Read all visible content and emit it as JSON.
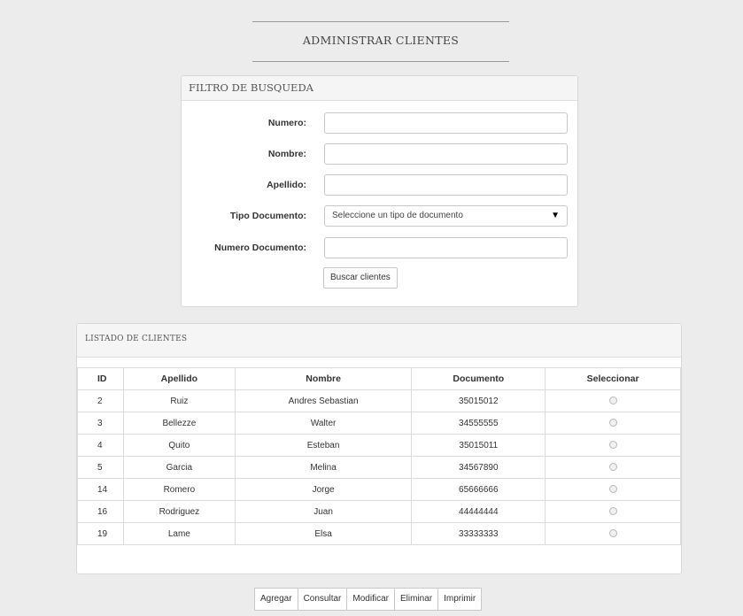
{
  "page": {
    "title": "ADMINISTRAR CLIENTES"
  },
  "filter": {
    "header": "FILTRO DE BUSQUEDA",
    "fields": [
      {
        "label": "Numero:",
        "value": ""
      },
      {
        "label": "Nombre:",
        "value": ""
      },
      {
        "label": "Apellido:",
        "value": ""
      },
      {
        "label": "Tipo Documento:",
        "value": "Seleccione un tipo de documento"
      },
      {
        "label": "Numero Documento:",
        "value": ""
      }
    ],
    "search_button": "Buscar clientes"
  },
  "clients": {
    "header": "LISTADO DE CLIENTES",
    "columns": [
      "ID",
      "Apellido",
      "Nombre",
      "Documento",
      "Seleccionar"
    ],
    "rows": [
      {
        "id": "2",
        "apellido": "Ruiz",
        "nombre": "Andres Sebastian",
        "documento": "35015012"
      },
      {
        "id": "3",
        "apellido": "Bellezze",
        "nombre": "Walter",
        "documento": "34555555"
      },
      {
        "id": "4",
        "apellido": "Quito",
        "nombre": "Esteban",
        "documento": "35015011"
      },
      {
        "id": "5",
        "apellido": "Garcia",
        "nombre": "Melina",
        "documento": "34567890"
      },
      {
        "id": "14",
        "apellido": "Romero",
        "nombre": "Jorge",
        "documento": "65666666"
      },
      {
        "id": "16",
        "apellido": "Rodriguez",
        "nombre": "Juan",
        "documento": "44444444"
      },
      {
        "id": "19",
        "apellido": "Lame",
        "nombre": "Elsa",
        "documento": "33333333"
      }
    ]
  },
  "actions": {
    "agregar": "Agregar",
    "consultar": "Consultar",
    "modificar": "Modificar",
    "eliminar": "Eliminar",
    "imprimir": "Imprimir"
  }
}
